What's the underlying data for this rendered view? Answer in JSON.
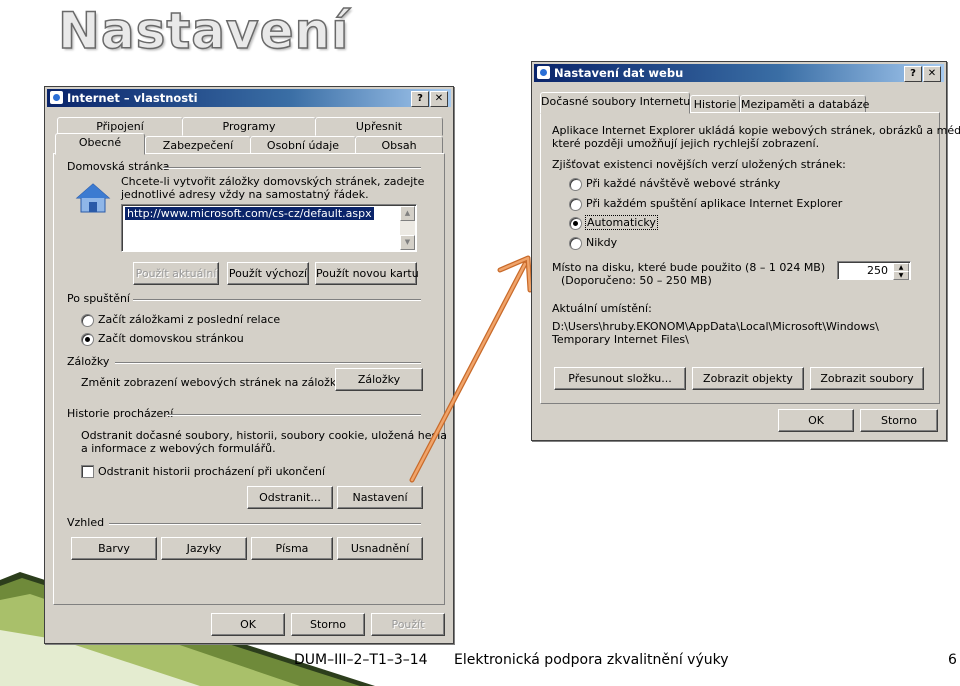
{
  "slide": {
    "title": "Nastavení",
    "footer_code": "DUM–III–2–T1–3–14",
    "footer_text": "Elektronická podpora zkvalitnění výuky",
    "page_number": "6"
  },
  "colors": {
    "arrow": "#e07b39",
    "titlebar": "#0a246a",
    "selection": "#0a246a"
  },
  "internet_options": {
    "title": "Internet – vlastnosti",
    "help": "?",
    "close": "✕",
    "tabs_row1": [
      "Připojení",
      "Programy",
      "Upřesnit"
    ],
    "tabs_row2": [
      "Obecné",
      "Zabezpečení",
      "Osobní údaje",
      "Obsah"
    ],
    "home": {
      "label": "Domovská stránka",
      "desc1": "Chcete-li vytvořit záložky domovských stránek, zadejte",
      "desc2": "jednotlivé adresy vždy na samostatný řádek.",
      "url": "http://www.microsoft.com/cs-cz/default.aspx",
      "btn_current": "Použít aktuální",
      "btn_default": "Použít výchozí",
      "btn_new_tab": "Použít novou kartu"
    },
    "startup": {
      "label": "Po spuštění",
      "opt1": "Začít záložkami z poslední relace",
      "opt2": "Začít domovskou stránkou"
    },
    "tabs_group": {
      "label": "Záložky",
      "desc": "Změnit zobrazení webových stránek na záložkách.",
      "btn": "Záložky"
    },
    "history": {
      "label": "Historie procházení",
      "desc1": "Odstranit dočasné soubory, historii, soubory cookie, uložená hesla",
      "desc2": "a informace z webových formulářů.",
      "checkbox": "Odstranit historii procházení při ukončení",
      "btn_delete": "Odstranit...",
      "btn_settings": "Nastavení"
    },
    "appearance": {
      "label": "Vzhled",
      "btn_colors": "Barvy",
      "btn_languages": "Jazyky",
      "btn_fonts": "Písma",
      "btn_access": "Usnadnění"
    },
    "ok": "OK",
    "cancel": "Storno",
    "apply": "Použít"
  },
  "web_settings": {
    "title": "Nastavení dat webu",
    "help": "?",
    "close": "✕",
    "tabs": [
      "Dočasné soubory Internetu",
      "Historie",
      "Mezipaměti a databáze"
    ],
    "desc1": "Aplikace Internet Explorer ukládá kopie webových stránek, obrázků a médií,",
    "desc2": "které později umožňují jejich rychlejší zobrazení.",
    "check_label": "Zjišťovat existenci novějších verzí uložených stránek:",
    "opt1": "Při každé návštěvě webové stránky",
    "opt2": "Při každém spuštění aplikace Internet Explorer",
    "opt3": "Automaticky",
    "opt4": "Nikdy",
    "disk1": "Místo na disku, které bude použito (8 – 1 024 MB)",
    "disk2": "(Doporučeno: 50 – 250 MB)",
    "disk_value": "250",
    "location_label": "Aktuální umístění:",
    "location1": "D:\\Users\\hruby.EKONOM\\AppData\\Local\\Microsoft\\Windows\\",
    "location2": "Temporary Internet Files\\",
    "btn_move": "Přesunout složku...",
    "btn_objects": "Zobrazit objekty",
    "btn_files": "Zobrazit soubory",
    "ok": "OK",
    "cancel": "Storno"
  }
}
